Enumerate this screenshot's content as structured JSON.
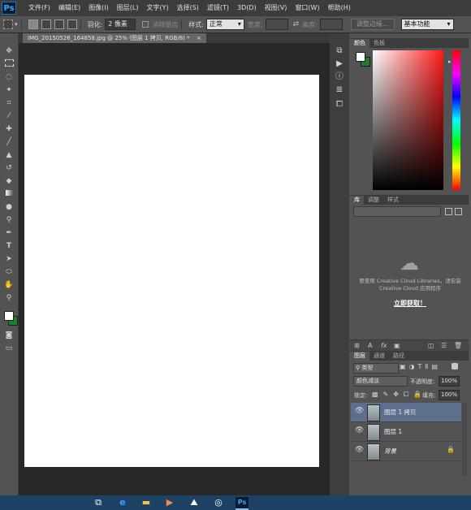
{
  "app": {
    "logo": "Ps"
  },
  "menu": [
    "文件(F)",
    "编辑(E)",
    "图像(I)",
    "图层(L)",
    "文字(Y)",
    "选择(S)",
    "滤镜(T)",
    "3D(D)",
    "视图(V)",
    "窗口(W)",
    "帮助(H)"
  ],
  "options": {
    "feather_label": "羽化:",
    "feather_value": "2 像素",
    "antialias_label": "消除锯齿",
    "style_label": "样式:",
    "style_value": "正常",
    "width_label": "宽度:",
    "height_label": "高度:",
    "refine_edge": "调整边缘...",
    "workspace": "基本功能"
  },
  "document": {
    "tab_title": "IMG_20150526_164858.jpg @ 25% (图层 1 拷贝, RGB/8) *",
    "close": "×"
  },
  "color_panel": {
    "tabs": [
      "颜色",
      "色板"
    ],
    "foreground": "#ffffff",
    "background": "#1d7d2a",
    "hue_marker": "▸"
  },
  "library_panel": {
    "tabs": [
      "库",
      "调整",
      "样式"
    ],
    "message": "要使用 Creative Cloud Libraries，请安装 Creative Cloud 应用程序",
    "action": "立即获取！"
  },
  "layers_panel": {
    "tabs": [
      "图层",
      "通道",
      "路径"
    ],
    "filter_kind": "类型",
    "blend_mode": "颜色减淡",
    "opacity_label": "不透明度:",
    "opacity_value": "100%",
    "lock_label": "锁定:",
    "fill_label": "填充:",
    "fill_value": "100%",
    "layers": [
      {
        "name": "图层 1 拷贝",
        "selected": true,
        "locked": false
      },
      {
        "name": "图层 1",
        "selected": false,
        "locked": false
      },
      {
        "name": "背景",
        "selected": false,
        "locked": true
      }
    ]
  },
  "toolbar_icons": [
    "move-icon",
    "marquee-icon",
    "lasso-icon",
    "magic-wand-icon",
    "crop-icon",
    "eyedropper-icon",
    "healing-brush-icon",
    "brush-icon",
    "clone-stamp-icon",
    "history-brush-icon",
    "eraser-icon",
    "gradient-icon",
    "blur-icon",
    "dodge-icon",
    "pen-icon",
    "type-icon",
    "path-selection-icon",
    "shape-icon",
    "hand-icon",
    "zoom-icon"
  ],
  "colors": {
    "accent_selection": "#5d6f8c",
    "taskbar": "#1c4266",
    "canvas": "#ffffff",
    "pasteboard": "#282828"
  }
}
